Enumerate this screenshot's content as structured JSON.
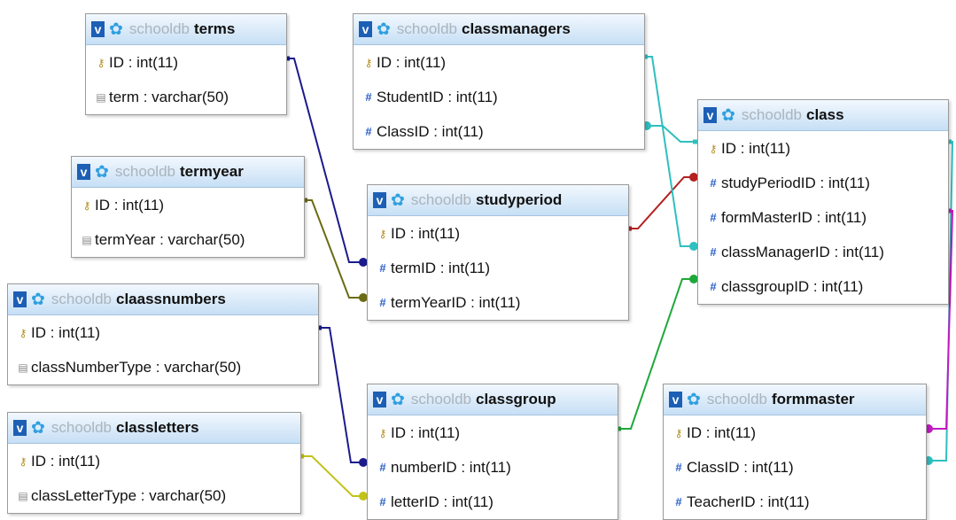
{
  "database": "schooldb",
  "view_button": "v",
  "tables": [
    {
      "id": "terms",
      "name": "terms",
      "columns": [
        {
          "text": "ID : int(11)",
          "icon": "key-icon"
        },
        {
          "text": "term : varchar(50)",
          "icon": "text-column-icon"
        }
      ]
    },
    {
      "id": "classmanagers",
      "name": "classmanagers",
      "columns": [
        {
          "text": "ID : int(11)",
          "icon": "key-icon"
        },
        {
          "text": "StudentID : int(11)",
          "icon": "numeric-column-icon"
        },
        {
          "text": "ClassID : int(11)",
          "icon": "numeric-column-icon"
        }
      ]
    },
    {
      "id": "class",
      "name": "class",
      "columns": [
        {
          "text": "ID : int(11)",
          "icon": "key-icon"
        },
        {
          "text": "studyPeriodID : int(11)",
          "icon": "numeric-column-icon"
        },
        {
          "text": "formMasterID : int(11)",
          "icon": "numeric-column-icon"
        },
        {
          "text": "classManagerID : int(11)",
          "icon": "numeric-column-icon"
        },
        {
          "text": "classgroupID : int(11)",
          "icon": "numeric-column-icon"
        }
      ]
    },
    {
      "id": "termyear",
      "name": "termyear",
      "columns": [
        {
          "text": "ID : int(11)",
          "icon": "key-icon"
        },
        {
          "text": "termYear : varchar(50)",
          "icon": "text-column-icon"
        }
      ]
    },
    {
      "id": "studyperiod",
      "name": "studyperiod",
      "columns": [
        {
          "text": "ID : int(11)",
          "icon": "key-icon"
        },
        {
          "text": "termID : int(11)",
          "icon": "numeric-column-icon"
        },
        {
          "text": "termYearID : int(11)",
          "icon": "numeric-column-icon"
        }
      ]
    },
    {
      "id": "claassnumbers",
      "name": "claassnumbers",
      "columns": [
        {
          "text": "ID : int(11)",
          "icon": "key-icon"
        },
        {
          "text": "classNumberType : varchar(50)",
          "icon": "text-column-icon"
        }
      ]
    },
    {
      "id": "classletters",
      "name": "classletters",
      "columns": [
        {
          "text": "ID : int(11)",
          "icon": "key-icon"
        },
        {
          "text": "classLetterType : varchar(50)",
          "icon": "text-column-icon"
        }
      ]
    },
    {
      "id": "classgroup",
      "name": "classgroup",
      "columns": [
        {
          "text": "ID : int(11)",
          "icon": "key-icon"
        },
        {
          "text": "numberID : int(11)",
          "icon": "numeric-column-icon"
        },
        {
          "text": "letterID : int(11)",
          "icon": "numeric-column-icon"
        }
      ]
    },
    {
      "id": "formmaster",
      "name": "formmaster",
      "columns": [
        {
          "text": "ID : int(11)",
          "icon": "key-icon"
        },
        {
          "text": "ClassID : int(11)",
          "icon": "numeric-column-icon"
        },
        {
          "text": "TeacherID : int(11)",
          "icon": "numeric-column-icon"
        }
      ]
    }
  ],
  "relations": [
    {
      "from": "terms",
      "to": "studyperiod.termID",
      "color": "#1b1b8c"
    },
    {
      "from": "termyear",
      "to": "studyperiod.termYearID",
      "color": "#6b6b12"
    },
    {
      "from": "claassnumbers",
      "to": "classgroup.numberID",
      "color": "#1b1b8c"
    },
    {
      "from": "classletters",
      "to": "classgroup.letterID",
      "color": "#c2c21a"
    },
    {
      "from": "studyperiod",
      "to": "class.studyPeriodID",
      "color": "#b52020"
    },
    {
      "from": "classmanagers",
      "to": "class.classManagerID",
      "color": "#2fbfbf"
    },
    {
      "from": "classgroup",
      "to": "class.classgroupID",
      "color": "#1fa83a"
    },
    {
      "from": "class",
      "to": "classmanagers.ClassID",
      "color": "#2fbfbf"
    },
    {
      "from": "class",
      "to": "formmaster.ClassID",
      "color": "#2fbfbf"
    },
    {
      "from": "formmaster",
      "to": "class.formMasterID",
      "color": "#c21ac2"
    }
  ]
}
